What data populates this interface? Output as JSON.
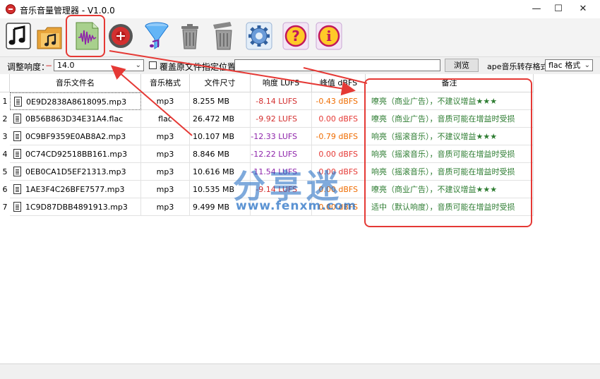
{
  "window": {
    "title": "音乐音量管理器 - V1.0.0",
    "controls": [
      "—",
      "☐",
      "✕"
    ]
  },
  "toolbar": {
    "buttons": [
      {
        "name": "add-music",
        "icon": "music-note-icon"
      },
      {
        "name": "add-folder",
        "icon": "folder-music-icon"
      },
      {
        "name": "analyze-loudness",
        "icon": "waveform-file-icon"
      },
      {
        "name": "record",
        "icon": "record-target-icon"
      },
      {
        "name": "convert",
        "icon": "funnel-music-icon"
      },
      {
        "name": "delete",
        "icon": "trash-icon"
      },
      {
        "name": "clear-all",
        "icon": "trash-full-icon"
      },
      {
        "name": "settings",
        "icon": "gear-icon"
      },
      {
        "name": "help",
        "icon": "question-icon"
      },
      {
        "name": "about",
        "icon": "info-icon"
      }
    ]
  },
  "options": {
    "loudness_label": "调整响度：",
    "minus_sign": "−",
    "loudness_value": "14.0",
    "overwrite_label": "覆盖原文件",
    "location_label": "指定位置",
    "location_value": "",
    "browse_label": "浏览",
    "ape_label": "ape音乐转存格式",
    "format_value": "flac 格式"
  },
  "table": {
    "headers": [
      "音乐文件名",
      "音乐格式",
      "文件尺寸",
      "响度 LUFS",
      "峰值 dBFS",
      "备注"
    ],
    "rows": [
      {
        "num": "1",
        "name": "0E9D2838A8618095.mp3",
        "format": "mp3",
        "size": "8.255 MB",
        "lufs": "-8.14 LUFS",
        "dbfs": "-0.43 dBFS",
        "note": "嘹亮（商业广告），不建议增益★★★"
      },
      {
        "num": "2",
        "name": "0B56B863D34E31A4.flac",
        "format": "flac",
        "size": "26.472 MB",
        "lufs": "-9.92 LUFS",
        "dbfs": "0.00 dBFS",
        "note": "嘹亮（商业广告），音质可能在增益时受损"
      },
      {
        "num": "3",
        "name": "0C9BF9359E0AB8A2.mp3",
        "format": "mp3",
        "size": "10.107 MB",
        "lufs": "-12.33 LUFS",
        "dbfs": "-0.79 dBFS",
        "note": "响亮（摇滚音乐），不建议增益★★★"
      },
      {
        "num": "4",
        "name": "0C74CD92518BB161.mp3",
        "format": "mp3",
        "size": "8.846 MB",
        "lufs": "-12.22 LUFS",
        "dbfs": "0.00 dBFS",
        "note": "响亮（摇滚音乐），音质可能在增益时受损"
      },
      {
        "num": "5",
        "name": "0EB0CA1D5EF21313.mp3",
        "format": "mp3",
        "size": "10.616 MB",
        "lufs": "-11.54 LUFS",
        "dbfs": "0.00 dBFS",
        "note": "响亮（摇滚音乐），音质可能在增益时受损"
      },
      {
        "num": "6",
        "name": "1AE3F4C26BFE7577.mp3",
        "format": "mp3",
        "size": "10.535 MB",
        "lufs": "-9.14 LUFS",
        "dbfs": "0.00 dBFS",
        "note": "嘹亮（商业广告），不建议增益★★★"
      },
      {
        "num": "7",
        "name": "1C9D87DBB4891913.mp3",
        "format": "mp3",
        "size": "9.499 MB",
        "lufs": "",
        "dbfs": "0.00 dBFS",
        "note": "适中（默认响度），音质可能在增益时受损"
      }
    ]
  },
  "watermark": {
    "big": "分享迷",
    "small": "www.fenxm.com"
  },
  "colors": {
    "highlight": "#e53935",
    "note_text": "#2e7d32",
    "lufs_red": "#d32f2f",
    "lufs_purple": "#8e24aa"
  }
}
